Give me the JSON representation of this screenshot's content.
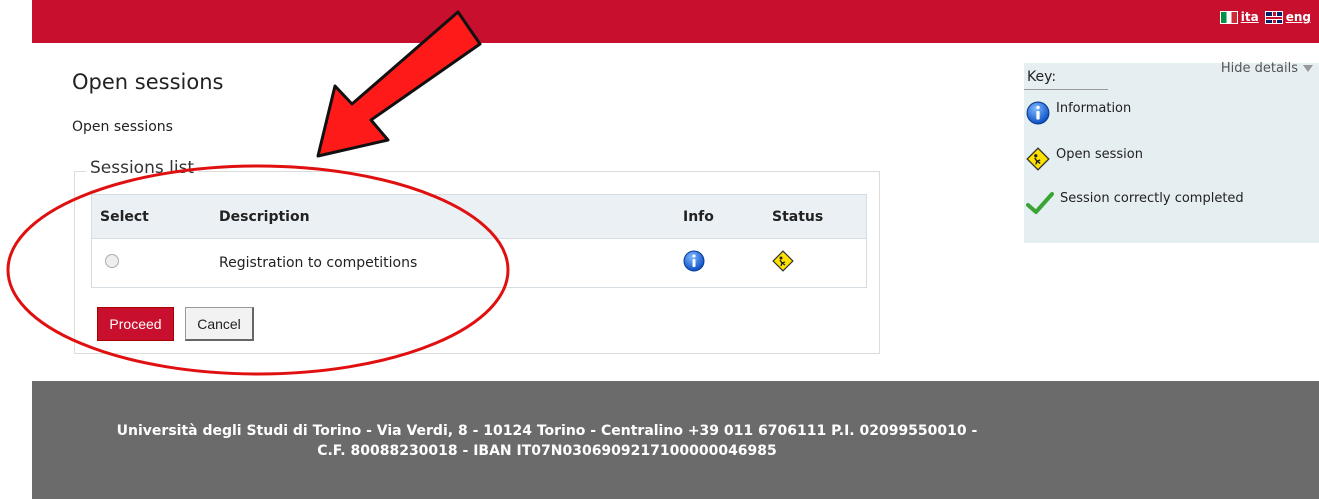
{
  "header": {
    "lang_it": "ita",
    "lang_en": "eng"
  },
  "page": {
    "title": "Open sessions",
    "subtitle": "Open sessions"
  },
  "sessions": {
    "legend": "Sessions list",
    "columns": [
      "Select",
      "Description",
      "Info",
      "Status"
    ],
    "rows": [
      {
        "description": "Registration to competitions",
        "info_icon": "info-icon",
        "status_icon": "open-session-icon"
      }
    ],
    "proceed_label": "Proceed",
    "cancel_label": "Cancel"
  },
  "key": {
    "title": "Key:",
    "hide_details": "Hide details",
    "items": [
      {
        "icon": "info-icon",
        "label": "Information"
      },
      {
        "icon": "open-session-icon",
        "label": "Open session"
      },
      {
        "icon": "check-icon",
        "label": "Session correctly completed"
      }
    ]
  },
  "footer": {
    "line1": "Università degli Studi di Torino - Via Verdi, 8 - 10124 Torino - Centralino +39 011 6706111 P.I. 02099550010 -",
    "line2": "C.F. 80088230018 - IBAN IT07N0306909217100000046985"
  },
  "colors": {
    "brand_red": "#c8102e",
    "footer_gray": "#6b6b6b",
    "key_bg": "#e5eef1"
  }
}
